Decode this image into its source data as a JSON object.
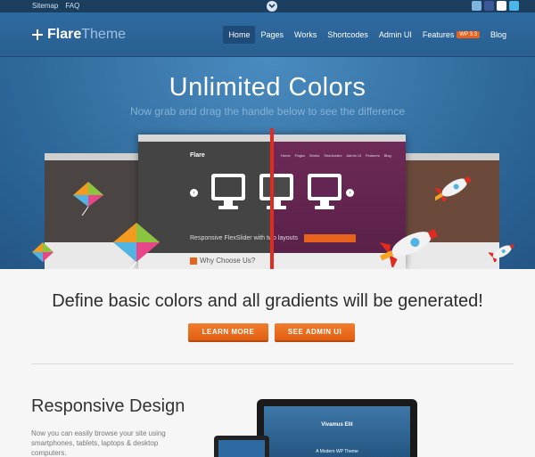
{
  "topbar": {
    "links": [
      "Sitemap",
      "FAQ"
    ],
    "social_icons": [
      "finder-icon",
      "facebook-icon",
      "flickr-icon",
      "twitter-icon"
    ]
  },
  "header": {
    "logo_part1": "Flare",
    "logo_part2": "Theme",
    "nav": [
      {
        "label": "Home",
        "active": true
      },
      {
        "label": "Pages"
      },
      {
        "label": "Works"
      },
      {
        "label": "Shortcodes"
      },
      {
        "label": "Admin UI"
      },
      {
        "label": "Features",
        "badge": "WP 3.3"
      },
      {
        "label": "Blog"
      }
    ]
  },
  "hero": {
    "title": "Unlimited Colors",
    "subtitle": "Now grab and drag the handle below to see the difference",
    "shot": {
      "logo": "Flare",
      "nav": [
        "Home",
        "Pages",
        "Works",
        "Shortcodes",
        "Admin UI",
        "Features",
        "Blog"
      ],
      "caption": "Responsive FlexSlider with two layouts",
      "why": "Why Choose Us?"
    }
  },
  "section2": {
    "title": "Define basic colors and all gradients will be generated!",
    "btn_learn": "LEARN MORE",
    "btn_admin": "SEE ADMIN UI"
  },
  "section3": {
    "title": "Responsive Design",
    "text_lines": [
      "Now you can easily browse your site using",
      "smartphones, tablets, laptops & desktop",
      "computers."
    ],
    "laptop_heading": "Vivamus Elit",
    "laptop_caption": "A Modern WP Theme"
  },
  "colors": {
    "accent": "#e8621c",
    "header_blue": "#2d6aa1",
    "handle": "#e12a20"
  }
}
